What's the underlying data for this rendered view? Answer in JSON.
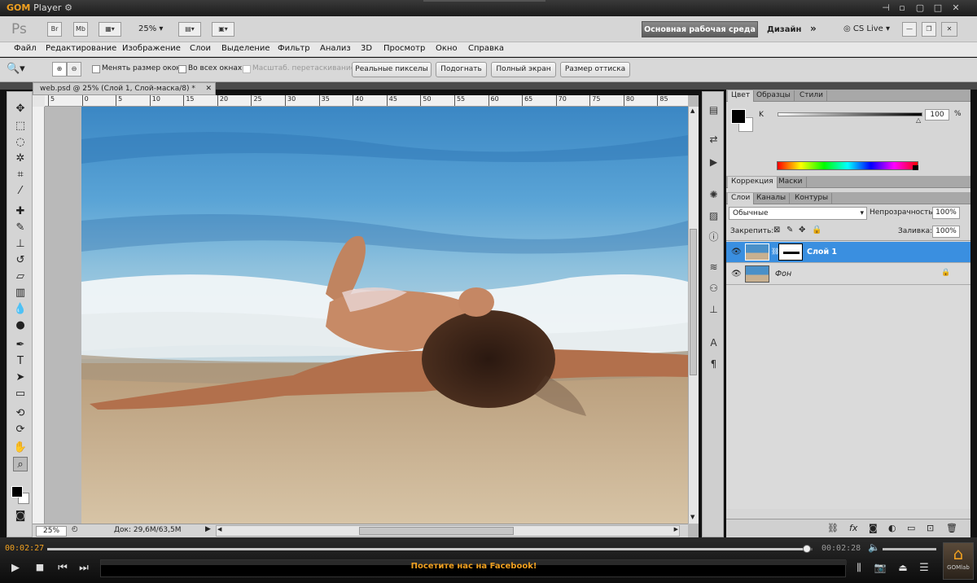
{
  "player": {
    "brand_gom": "GOM",
    "brand_player": "Player",
    "time_current": "00:02:27",
    "time_total": "00:02:28",
    "progress": 0.993,
    "banner": "Посетите нас на Facebook!",
    "home_label": "GOMlab"
  },
  "appbar": {
    "ps_logo": "Ps",
    "br": "Br",
    "mb": "Mb",
    "zoom": "25%",
    "workspace_active": "Основная рабочая среда",
    "workspace_design": "Дизайн",
    "cs_live": "CS Live"
  },
  "menu": [
    "Файл",
    "Редактирование",
    "Изображение",
    "Слои",
    "Выделение",
    "Фильтр",
    "Анализ",
    "3D",
    "Просмотр",
    "Окно",
    "Справка"
  ],
  "options": {
    "resize_windows": "Менять размер окон",
    "all_windows": "Во всех окнах",
    "scrubby": "Масштаб. перетаскиванием",
    "actual_pixels": "Реальные пикселы",
    "fit": "Подогнать",
    "full_screen": "Полный экран",
    "print_size": "Размер оттиска"
  },
  "document": {
    "tab_title": "web.psd @ 25% (Слой 1, Слой-маска/8) *",
    "ruler_h": [
      "5",
      "0",
      "5",
      "10",
      "15",
      "20",
      "25",
      "30",
      "35",
      "40",
      "45",
      "50",
      "55",
      "60",
      "65",
      "70",
      "75",
      "80",
      "85"
    ],
    "zoom": "25%",
    "doc_size": "Док: 29,6M/63,5M"
  },
  "color_panel": {
    "tabs": [
      "Цвет",
      "Образцы",
      "Стили"
    ],
    "channel": "K",
    "value": "100",
    "unit": "%"
  },
  "adjust_panel": {
    "tabs": [
      "Коррекция",
      "Маски"
    ]
  },
  "layers_panel": {
    "tabs": [
      "Слои",
      "Каналы",
      "Контуры"
    ],
    "blend_mode": "Обычные",
    "opacity_label": "Непрозрачность:",
    "opacity": "100%",
    "lock_label": "Закрепить:",
    "fill_label": "Заливка:",
    "fill": "100%",
    "layers": [
      {
        "name": "Слой 1",
        "selected": true
      },
      {
        "name": "Фон",
        "selected": false
      }
    ]
  },
  "colors": {
    "accent": "#3a8fe0",
    "gom_orange": "#f0a020",
    "layer_selected": "#3a8fe0"
  }
}
